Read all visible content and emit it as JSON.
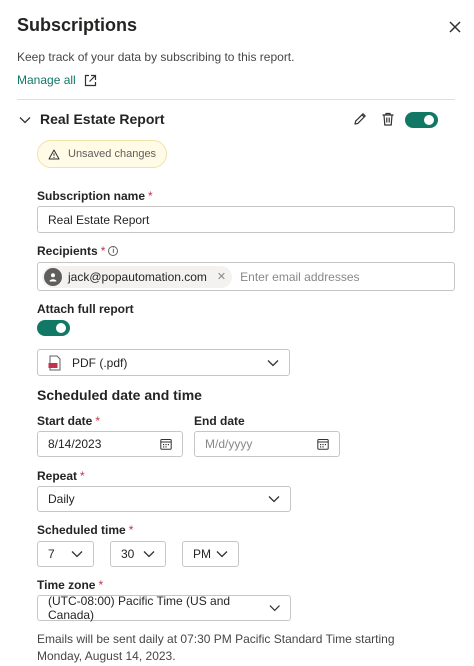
{
  "panel": {
    "title": "Subscriptions",
    "description": "Keep track of your data by subscribing to this report.",
    "manage_all": "Manage all"
  },
  "subscription": {
    "report_title": "Real Estate Report",
    "enabled": true,
    "badge": "Unsaved changes",
    "name_label": "Subscription name",
    "name_value": "Real Estate Report",
    "recipients_label": "Recipients",
    "recipient_chip": "jack@popautomation.com",
    "recipients_placeholder": "Enter email addresses",
    "attach_label": "Attach full report",
    "attach_enabled": true,
    "format_value": "PDF (.pdf)"
  },
  "schedule": {
    "heading": "Scheduled date and time",
    "start_label": "Start date",
    "start_value": "8/14/2023",
    "end_label": "End date",
    "end_placeholder": "M/d/yyyy",
    "repeat_label": "Repeat",
    "repeat_value": "Daily",
    "time_label": "Scheduled time",
    "hour": "7",
    "minute": "30",
    "ampm": "PM",
    "timezone_label": "Time zone",
    "timezone_value": "(UTC-08:00) Pacific Time (US and Canada)",
    "note": "Emails will be sent daily at 07:30 PM Pacific Standard Time starting Monday, August 14, 2023."
  },
  "required_marker": "*",
  "colors": {
    "accent": "#117865",
    "required": "#c4314b",
    "badge_bg": "#fffbe6"
  }
}
